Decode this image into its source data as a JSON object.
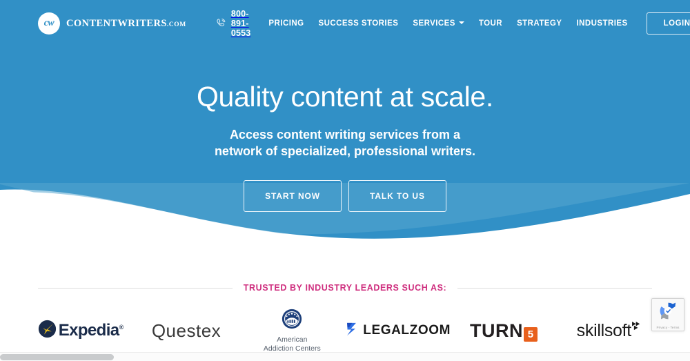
{
  "header": {
    "brand": {
      "mark": "cw",
      "name": "CONTENTWRITERS",
      "tld": ".COM"
    },
    "phone": {
      "icon": "phone-icon",
      "number": "800-891-0553"
    },
    "nav_items": [
      {
        "label": "PRICING",
        "has_dropdown": false
      },
      {
        "label": "SUCCESS STORIES",
        "has_dropdown": false
      },
      {
        "label": "SERVICES",
        "has_dropdown": true
      },
      {
        "label": "TOUR",
        "has_dropdown": false
      },
      {
        "label": "STRATEGY",
        "has_dropdown": false
      },
      {
        "label": "INDUSTRIES",
        "has_dropdown": false
      }
    ],
    "login_label": "LOGIN"
  },
  "hero": {
    "headline": "Quality content at scale.",
    "subhead_line1": "Access content writing services from a",
    "subhead_line2": "network of specialized, professional writers.",
    "cta_primary": "START NOW",
    "cta_secondary": "TALK TO US",
    "background_color": "#3190c6",
    "wave_light_color": "#55a6d0"
  },
  "trusted": {
    "label": "TRUSTED BY INDUSTRY LEADERS SUCH AS:",
    "label_color": "#cf2f7f",
    "logos": [
      {
        "name": "Expedia",
        "wordmark": "Expedia",
        "trademark": "®",
        "accent": "#1b2c4a",
        "star": "#f0c419"
      },
      {
        "name": "Questex",
        "wordmark": "Questex",
        "accent": "#3a3a3a"
      },
      {
        "name": "American Addiction Centers",
        "line1": "American",
        "line2": "Addiction Centers",
        "accent": "#1d3f7a"
      },
      {
        "name": "LegalZoom",
        "wordmark": "LEGALZOOM",
        "mark": "Z",
        "accent": "#1a1a1a",
        "mark_color": "#2f6fe4"
      },
      {
        "name": "TURN5",
        "wordmark": "TURN",
        "badge": "5",
        "accent": "#231f20",
        "badge_color": "#e8601c"
      },
      {
        "name": "Skillsoft",
        "wordmark": "skillsoft",
        "accent": "#1a1a1a"
      }
    ]
  },
  "recaptcha": {
    "legal": "Privacy - Terms",
    "icon": "recaptcha-icon"
  },
  "scrollbar": {
    "orientation": "horizontal"
  }
}
